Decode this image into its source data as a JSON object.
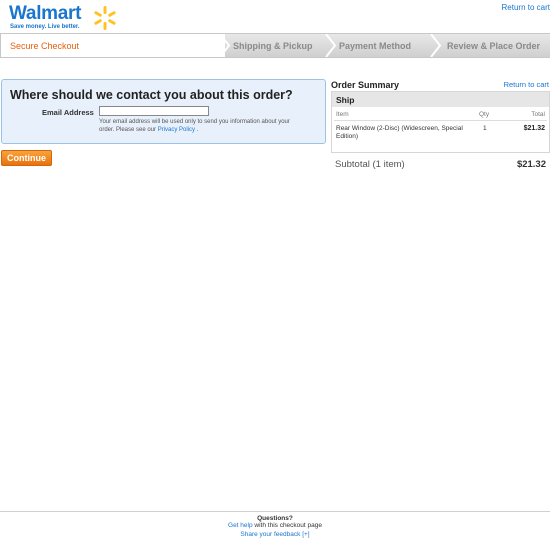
{
  "header": {
    "logo_text": "Walmart",
    "tagline": "Save money. Live better.",
    "return_to_cart": "Return to cart"
  },
  "progress": {
    "current_step": "Secure Checkout",
    "steps": [
      "Shipping & Pickup",
      "Payment Method",
      "Review & Place Order"
    ]
  },
  "contact": {
    "heading": "Where should we contact you about this order?",
    "email_label": "Email Address",
    "email_value": "",
    "help_text": "Your email address will be used only to send you information about your order. Please see our",
    "privacy_link": "Privacy Policy",
    "help_end": "."
  },
  "continue_label": "Continue",
  "summary": {
    "title": "Order Summary",
    "return_to_cart": "Return to cart",
    "section": "Ship",
    "columns": {
      "item": "Item",
      "qty": "Qty",
      "total": "Total"
    },
    "items": [
      {
        "name": "Rear Window (2-Disc) (Widescreen, Special Edition)",
        "qty": "1",
        "total": "$21.32"
      }
    ],
    "subtotal_label": "Subtotal (1 item)",
    "subtotal_value": "$21.32"
  },
  "footer": {
    "questions": "Questions?",
    "help_link": "Get help",
    "help_text": "with this checkout page",
    "feedback": "Share your feedback",
    "feedback_icon": "[+]"
  },
  "colors": {
    "brand_blue": "#1a75cf",
    "spark_yellow": "#ffc220",
    "accent_orange": "#e8730d",
    "contact_bg": "#e8f1fb"
  }
}
